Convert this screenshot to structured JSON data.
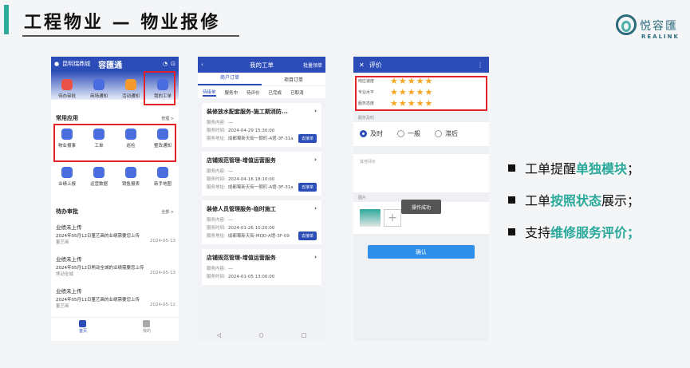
{
  "slide": {
    "title": "工程物业 — 物业报修",
    "logo_cn": "悦容匯",
    "logo_en": "REALINK"
  },
  "phone1": {
    "location": "昆明瑞鼎城",
    "app_name": "容匯通",
    "top_icons": [
      "待办审批",
      "商场通知",
      "活动通知",
      "我的工单"
    ],
    "common_title": "常用应用",
    "common_more": "管理 >",
    "apps_row1": [
      "物业报事",
      "工单",
      "巡检",
      "整改通知"
    ],
    "apps_row2": [
      "业绩上报",
      "运营数据",
      "销售报表",
      "新手地图"
    ],
    "badge": "...",
    "pending_title": "待办审批",
    "pending_more": "全部 >",
    "approvals": [
      {
        "title": "业绩未上传",
        "desc": "2024年05月12日董艺画的业绩需要您上传",
        "shop": "董艺画",
        "date": "2024-05-13"
      },
      {
        "title": "业绩未上传",
        "desc": "2024年05月12日熊动全城的业绩需要您上传",
        "shop": "熊动全城",
        "date": "2024-05-13"
      },
      {
        "title": "业绩未上传",
        "desc": "2024年05月11日董艺画的业绩需要您上传",
        "shop": "董艺画",
        "date": "2024-05-12"
      }
    ],
    "tabbar": [
      "首页",
      "我的"
    ]
  },
  "phone2": {
    "title": "我的工单",
    "right": "批量领单",
    "tabs": [
      "商户订单",
      "项目订单"
    ],
    "subtabs": [
      "待接单",
      "服务中",
      "待评价",
      "已完成",
      "已取消"
    ],
    "cards": [
      {
        "title": "装修放水配套服务-施工期消防...",
        "content_label": "服务内容:",
        "content": "---",
        "time_label": "服务时间:",
        "time": "2024-04-29 15:30:00",
        "addr_label": "服务地址:",
        "addr": "成都蜀新天街一朝町-A馆-3F-31a",
        "btn": "去接单"
      },
      {
        "title": "店铺规范管理-增值运营服务",
        "content_label": "服务内容:",
        "content": "---",
        "time_label": "服务时间:",
        "time": "2024-04-16 18:10:00",
        "addr_label": "服务地址:",
        "addr": "成都蜀新天街一朝町-A馆-3F-31a",
        "btn": "去接单"
      },
      {
        "title": "装修人员管理服务-临时施工",
        "content_label": "服务内容:",
        "content": "---",
        "time_label": "服务时间:",
        "time": "2024-01-26 10:20:00",
        "addr_label": "服务地址:",
        "addr": "成都蜀新天街-MQD-A馆-3F-09",
        "btn": "去接单"
      },
      {
        "title": "店铺规范管理-增值运营服务",
        "content_label": "服务内容:",
        "content": "---",
        "time_label": "服务时间:",
        "time": "2024-01-05 13:00:00",
        "addr_label": "",
        "addr": "",
        "btn": ""
      }
    ]
  },
  "phone3": {
    "title": "评价",
    "ratings": [
      {
        "label": "响应速度",
        "stars": "★★★★★"
      },
      {
        "label": "专业水平",
        "stars": "★★★★★"
      },
      {
        "label": "服务态度",
        "stars": "★★★★★"
      }
    ],
    "timeliness_label": "服务及时",
    "options": [
      "及时",
      "一般",
      "滞后"
    ],
    "comment_placeholder": "其他评价",
    "photo_label": "图片",
    "toast": "操作成功",
    "confirm": "确认"
  },
  "bullets": [
    {
      "pre": "工单提醒",
      "hl": "单独模块",
      "post": "；"
    },
    {
      "pre": "工单",
      "hl": "按照状态",
      "post": "展示；"
    },
    {
      "pre": "支持",
      "hl": "维修服务评价；",
      "post": ""
    }
  ],
  "colors": {
    "accent": "#2fa99a",
    "brand_blue": "#2c4db8",
    "highlight_red": "#e0222b",
    "star": "#f5a623"
  }
}
